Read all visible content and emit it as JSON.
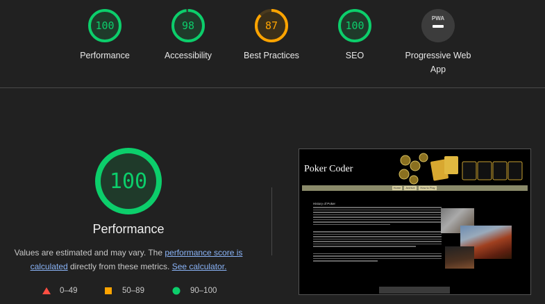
{
  "categories": [
    {
      "score": "100",
      "label": "Performance",
      "color": "#0cce6b",
      "fraction": 1.0
    },
    {
      "score": "98",
      "label": "Accessibility",
      "color": "#0cce6b",
      "fraction": 0.98
    },
    {
      "score": "87",
      "label": "Best Practices",
      "color": "#ffa400",
      "fraction": 0.87
    },
    {
      "score": "100",
      "label": "SEO",
      "color": "#0cce6b",
      "fraction": 1.0
    },
    {
      "label_line1": "Progressive Web",
      "label_line2": "App",
      "pwa_badge": "PWA"
    }
  ],
  "performance": {
    "score": "100",
    "fraction": 1.0,
    "title": "Performance",
    "note_prefix": "Values are estimated and may vary. The ",
    "note_link1_line1": "performance score is",
    "note_link1_line2": "calculated",
    "note_middle": " directly from these metrics. ",
    "note_link2": "See calculator."
  },
  "legend": [
    {
      "range": "0–49",
      "icon": "triangle-icon",
      "color": "#ff4e42"
    },
    {
      "range": "50–89",
      "icon": "square-icon",
      "color": "#ffa400"
    },
    {
      "range": "90–100",
      "icon": "circle-icon",
      "color": "#0cce6b"
    }
  ],
  "screenshot": {
    "site_title": "Poker Coder",
    "nav": [
      "Home",
      "Archive",
      "How to Play"
    ],
    "heading": "History of Poker"
  }
}
